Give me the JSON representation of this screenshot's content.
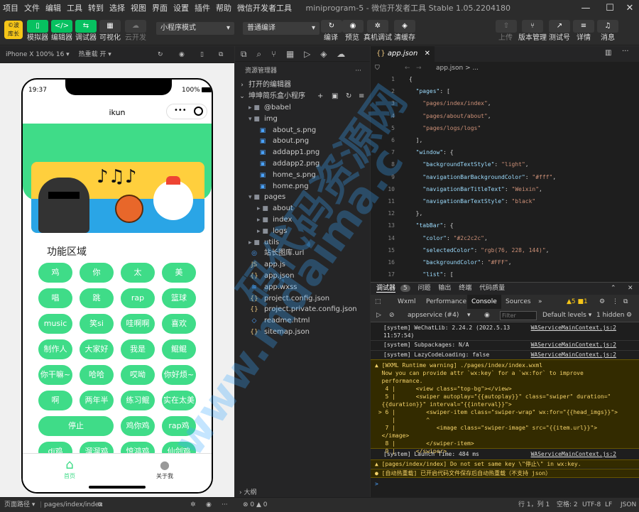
{
  "menubar": {
    "items": [
      "项目",
      "文件",
      "编辑",
      "工具",
      "转到",
      "选择",
      "视图",
      "界面",
      "设置",
      "插件",
      "帮助",
      "微信开发者工具"
    ],
    "window_title": "miniprogram-5 - 微信开发者工具 Stable 1.05.2204180"
  },
  "toolbar": {
    "logo": "©波 库长",
    "simulator": "模拟器",
    "editor": "编辑器",
    "debugger": "调试器",
    "visual": "可视化",
    "cloud": "云开发",
    "mode": "小程序模式",
    "compile_mode": "普通编译",
    "compile": "编译",
    "preview": "预览",
    "realdebug": "真机调试",
    "clearcache": "清缓存",
    "upload": "上传",
    "version": "版本管理",
    "test": "测试号",
    "details": "详情",
    "messages": "消息"
  },
  "simulator": {
    "device": "iPhone X 100% 16 ▾",
    "hotreload": "热重载 开 ▾",
    "time": "19:37",
    "battery": "100%",
    "nav_title": "ikun",
    "section_title": "功能区域",
    "buttons": [
      "鸡",
      "你",
      "太",
      "美",
      "唱",
      "跳",
      "rap",
      "篮球",
      "music",
      "笑si",
      "哇啊啊",
      "喜欢",
      "制作人",
      "大家好",
      "我是",
      "鲲鲲",
      "你干嘛~",
      "哈哈",
      "哎呦",
      "你好烦~",
      "啊",
      "两年半",
      "练习鲲",
      "实在太美",
      "停止",
      "鸡你鸡",
      "rap鸡",
      "di鸡",
      "溜溜鸡",
      "惊鸿鸡",
      "仙剑鸡"
    ],
    "tabs": [
      {
        "label": "首页"
      },
      {
        "label": "关于我"
      }
    ]
  },
  "explorer": {
    "title": "资源管理器",
    "open_editors": "打开的编辑器",
    "project": "坤坤简乐盒小程序",
    "tree": [
      {
        "name": "@babel",
        "icon": "▸ ■",
        "level": 1
      },
      {
        "name": "img",
        "icon": "▾ ■",
        "level": 1
      },
      {
        "name": "about_s.png",
        "icon": "▣",
        "level": 2
      },
      {
        "name": "about.png",
        "icon": "▣",
        "level": 2
      },
      {
        "name": "addapp1.png",
        "icon": "▣",
        "level": 2
      },
      {
        "name": "addapp2.png",
        "icon": "▣",
        "level": 2
      },
      {
        "name": "home_s.png",
        "icon": "▣",
        "level": 2
      },
      {
        "name": "home.png",
        "icon": "▣",
        "level": 2
      },
      {
        "name": "pages",
        "icon": "▾ ■",
        "level": 1
      },
      {
        "name": "about",
        "icon": "▸ ■",
        "level": 2
      },
      {
        "name": "index",
        "icon": "▸ ■",
        "level": 2
      },
      {
        "name": "logs",
        "icon": "▸ ■",
        "level": 2
      },
      {
        "name": "utils",
        "icon": "▸ ■",
        "level": 1
      },
      {
        "name": "站长图库.url",
        "icon": "◎",
        "level": 1
      },
      {
        "name": "app.js",
        "icon": "JS",
        "level": 1
      },
      {
        "name": "app.json",
        "icon": "{}",
        "level": 1
      },
      {
        "name": "app.wxss",
        "icon": "≋",
        "level": 1
      },
      {
        "name": "project.config.json",
        "icon": "{}",
        "level": 1
      },
      {
        "name": "project.private.config.json",
        "icon": "{}",
        "level": 1
      },
      {
        "name": "readme.html",
        "icon": "◇",
        "level": 1
      },
      {
        "name": "sitemap.json",
        "icon": "{}",
        "level": 1
      }
    ],
    "outline": "大纲"
  },
  "editor": {
    "tab": "app.json",
    "breadcrumb": "app.json > ...",
    "lines": [
      {
        "n": "1",
        "t": [
          [
            "p",
            "{"
          ]
        ]
      },
      {
        "n": "2",
        "t": [
          [
            "k",
            "  \"pages\""
          ],
          [
            "p",
            ": ["
          ]
        ]
      },
      {
        "n": "3",
        "t": [
          [
            "s",
            "    \"pages/index/index\""
          ],
          [
            "p",
            ","
          ]
        ]
      },
      {
        "n": "4",
        "t": [
          [
            "s",
            "    \"pages/about/about\""
          ],
          [
            "p",
            ","
          ]
        ]
      },
      {
        "n": "5",
        "t": [
          [
            "s",
            "    \"pages/logs/logs\""
          ]
        ]
      },
      {
        "n": "6",
        "t": [
          [
            "p",
            "  ],"
          ]
        ]
      },
      {
        "n": "7",
        "t": [
          [
            "k",
            "  \"window\""
          ],
          [
            "p",
            ": {"
          ]
        ]
      },
      {
        "n": "8",
        "t": [
          [
            "k",
            "    \"backgroundTextStyle\""
          ],
          [
            "p",
            ": "
          ],
          [
            "s",
            "\"light\""
          ],
          [
            "p",
            ","
          ]
        ]
      },
      {
        "n": "9",
        "t": [
          [
            "k",
            "    \"navigationBarBackgroundColor\""
          ],
          [
            "p",
            ": "
          ],
          [
            "s",
            "\"#fff\""
          ],
          [
            "p",
            ","
          ]
        ]
      },
      {
        "n": "10",
        "t": [
          [
            "k",
            "    \"navigationBarTitleText\""
          ],
          [
            "p",
            ": "
          ],
          [
            "s",
            "\"Weixin\""
          ],
          [
            "p",
            ","
          ]
        ]
      },
      {
        "n": "11",
        "t": [
          [
            "k",
            "    \"navigationBarTextStyle\""
          ],
          [
            "p",
            ": "
          ],
          [
            "s",
            "\"black\""
          ]
        ]
      },
      {
        "n": "12",
        "t": [
          [
            "p",
            "  },"
          ]
        ]
      },
      {
        "n": "13",
        "t": [
          [
            "k",
            "  \"tabBar\""
          ],
          [
            "p",
            ": {"
          ]
        ]
      },
      {
        "n": "14",
        "t": [
          [
            "k",
            "    \"color\""
          ],
          [
            "p",
            ": "
          ],
          [
            "s",
            "\"#2c2c2c\""
          ],
          [
            "p",
            ","
          ]
        ]
      },
      {
        "n": "15",
        "t": [
          [
            "k",
            "    \"selectedColor\""
          ],
          [
            "p",
            ": "
          ],
          [
            "s",
            "\"rgb(76, 228, 144)\""
          ],
          [
            "p",
            ","
          ]
        ]
      },
      {
        "n": "16",
        "t": [
          [
            "k",
            "    \"backgroundColor\""
          ],
          [
            "p",
            ": "
          ],
          [
            "s",
            "\"#FFF\""
          ],
          [
            "p",
            ","
          ]
        ]
      },
      {
        "n": "17",
        "t": [
          [
            "k",
            "    \"list\""
          ],
          [
            "p",
            ": ["
          ]
        ]
      }
    ]
  },
  "devtools": {
    "tabs": [
      "调试器",
      "5",
      "问题",
      "输出",
      "终端",
      "代码质量"
    ],
    "subtabs": [
      "Wxml",
      "Performance",
      "Console",
      "Sources",
      "»"
    ],
    "counts": "▲5 ■1",
    "context": "appservice (#4)",
    "filter": "Filter",
    "levels": "Default levels ▾",
    "hidden": "1 hidden",
    "logs": [
      {
        "text": "[system] WeChatLib: 2.24.2 (2022.5.13\n11:57:54)",
        "link": "WAServiceMainContext.js:2"
      },
      {
        "text": "[system] Subpackages: N/A",
        "link": "WAServiceMainContext.js:2"
      },
      {
        "text": "[system] LazyCodeLoading: false",
        "link": "WAServiceMainContext.js:2"
      }
    ],
    "warning": "▲ [WXML Runtime warning] ./pages/index/index.wxml\n  Now you can provide attr `wx:key` for a `wx:for` to improve\n  performance.\n   4 |      <view class=\"top-bg\"></view>\n   5 |      <swiper autoplay=\"{{autoplay}}\" class=\"swiper\" duration=\"\n  {{duration}}\" interval=\"{{interval}}\">\n > 6 |         <swiper-item class=\"swiper-wrap\" wx:for=\"{{head_imgs}}\">\n     |         ^\n   7 |            <image class=\"swiper-image\" src=\"{{item.url}}\">\n  </image>\n   8 |         </swiper-item>\n   9 |      </swiper>",
    "launch": "[system] Launch Time: 484 ms",
    "launch_link": "WAServiceMainContext.js:2",
    "warn2": "▲ [pages/index/index] Do not set same key \\\"停止\\\" in wx:key.",
    "info": "● [自动热重载] 已开启代码文件保存后自动热重载（不支持 json）",
    "prompt": ">"
  },
  "statusbar": {
    "path_label": "页面路径 ▾",
    "path": "pages/index/index",
    "errors": "⊗ 0 ▲ 0",
    "position": "行 1，列 1",
    "spaces": "空格: 2",
    "encoding": "UTF-8",
    "eol": "LF",
    "lang": "JSON"
  },
  "watermark": {
    "line1": "码代码资源网",
    "line2": "www.mdaima.c"
  },
  "colors": {
    "accent": "#07c160",
    "mini_green": "#3fdc88"
  }
}
